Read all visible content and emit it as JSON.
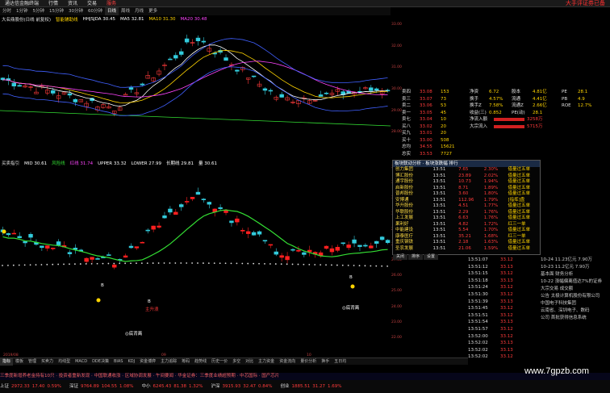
{
  "app": {
    "brand": "大手评证券已备"
  },
  "menu": [
    "通达信金融终端",
    "行情",
    "资讯",
    "交易",
    "服务"
  ],
  "menu_active_index": 4,
  "periods": [
    "分时",
    "1分钟",
    "5分钟",
    "15分钟",
    "30分钟",
    "60分钟",
    "日线",
    "周线",
    "月线",
    "更多"
  ],
  "period_active_index": 6,
  "main_legend": {
    "name": "大名鼎股份(日线 前复权)",
    "ind": "智能辅助线",
    "items": [
      {
        "label": "HHJSJDA",
        "value": "30.45",
        "color": "#ffffff"
      },
      {
        "label": "MA5",
        "value": "32.81",
        "color": "#ffffff"
      },
      {
        "label": "MA10",
        "value": "31.30",
        "color": "#ffd400"
      },
      {
        "label": "MA20",
        "value": "30.48",
        "color": "#ff44ff"
      }
    ]
  },
  "ind_legend": {
    "name": "买卖指引",
    "items": [
      {
        "label": "MID",
        "value": "30.61",
        "color": "#ffffff"
      },
      {
        "label": "风险线",
        "value": "",
        "color": "#33dd33"
      },
      {
        "label": "红线",
        "value": "31.74",
        "color": "#ff44ff"
      },
      {
        "label": "UPPER",
        "value": "33.32",
        "color": "#ffffff"
      },
      {
        "label": "LOWER",
        "value": "27.99",
        "color": "#ffffff"
      },
      {
        "label": "长期线",
        "value": "29.81",
        "color": "#ffffff"
      },
      {
        "label": "量",
        "value": "30.61",
        "color": "#ffffff"
      }
    ]
  },
  "main_scale": [
    "33.00",
    "32.00",
    "31.00",
    "30.00",
    "29.00",
    "28.00"
  ],
  "ind_scale": [
    "33.00",
    "32.00",
    "31.00",
    "30.00",
    "29.00",
    "28.00",
    "27.00",
    "26.00",
    "25.00",
    "24.00",
    "23.00",
    "22.00"
  ],
  "order_book": {
    "asks": [
      {
        "lvl": "卖四",
        "price": "33.08",
        "vol": "153"
      },
      {
        "lvl": "卖三",
        "price": "33.07",
        "vol": "73"
      },
      {
        "lvl": "卖二",
        "price": "33.06",
        "vol": "53"
      },
      {
        "lvl": "卖一",
        "price": "33.05",
        "vol": "45"
      },
      {
        "lvl": "卖七",
        "price": "33.04",
        "vol": "10"
      },
      {
        "lvl": "买八",
        "price": "33.02",
        "vol": "20"
      },
      {
        "lvl": "买九",
        "price": "33.01",
        "vol": "20"
      },
      {
        "lvl": "买十",
        "price": "33.00",
        "vol": "508"
      }
    ],
    "summary": [
      {
        "lvl": "总均",
        "price": "34.55",
        "vol": "15621"
      },
      {
        "lvl": "总实",
        "price": "33.53",
        "vol": "7727"
      }
    ]
  },
  "stats": [
    {
      "k": "净资",
      "v": "6.72",
      "k2": "股本",
      "v2": "4.81亿"
    },
    {
      "k": "换手",
      "v": "4.57%",
      "k2": "流通",
      "v2": "4.41亿"
    },
    {
      "k": "换手Z",
      "v": "7.58%",
      "k2": "流通Z",
      "v2": "2.66亿"
    },
    {
      "k": "收益(三)",
      "v": "0.852",
      "k2": "PE(动)",
      "v2": "28.1"
    }
  ],
  "flow": [
    {
      "k": "净流入额",
      "v": "3258万"
    },
    {
      "k": "大宗流入",
      "v": "5715万"
    }
  ],
  "pe": [
    {
      "k": "PE",
      "v": "28.1"
    },
    {
      "k": "PB",
      "v": "4.9"
    },
    {
      "k": "ROE",
      "v": "12.7%"
    }
  ],
  "popup": {
    "title": "板块联动分析 · 板块涨跌幅 排行",
    "rows": [
      {
        "name": "创力集团",
        "time": "13:51",
        "price": "7.65",
        "pct": "2.30%",
        "tag": "借量过五单"
      },
      {
        "name": "博汇股份",
        "time": "13:51",
        "price": "23.89",
        "pct": "2.02%",
        "tag": "借量过五单"
      },
      {
        "name": "通宇股份",
        "time": "13:51",
        "price": "10.73",
        "pct": "1.94%",
        "tag": "借量过五单"
      },
      {
        "name": "启新股份",
        "time": "13:51",
        "price": "8.71",
        "pct": "1.89%",
        "tag": "借量过五单"
      },
      {
        "name": "普邦股份",
        "time": "13:51",
        "price": "3.60",
        "pct": "1.80%",
        "tag": "借量过五单"
      },
      {
        "name": "安博通",
        "time": "13:51",
        "price": "112.96",
        "pct": "1.79%",
        "tag": "[指挥]盘"
      },
      {
        "name": "华升股份",
        "time": "13:51",
        "price": "4.51",
        "pct": "1.77%",
        "tag": "借量过五单"
      },
      {
        "name": "华联股份",
        "time": "13:51",
        "price": "2.29",
        "pct": "1.76%",
        "tag": "借量过五单"
      },
      {
        "name": "上工发展",
        "time": "13:51",
        "price": "6.63",
        "pct": "1.76%",
        "tag": "借量过五单"
      },
      {
        "name": "果利好",
        "time": "13:51",
        "price": "4.82",
        "pct": "1.72%",
        "tag": "红三一单"
      },
      {
        "name": "中能建设",
        "time": "13:51",
        "price": "5.54",
        "pct": "1.70%",
        "tag": "借量过五单"
      },
      {
        "name": "康泰医疗",
        "time": "13:51",
        "price": "35.21",
        "pct": "1.68%",
        "tag": "红三一单"
      },
      {
        "name": "重庆钢铁",
        "time": "13:51",
        "price": "2.18",
        "pct": "1.63%",
        "tag": "借量过五单"
      },
      {
        "name": "圣农发展",
        "time": "13:51",
        "price": "21.06",
        "pct": "1.59%",
        "tag": "借量过五单"
      }
    ],
    "foot": [
      "关闭",
      "排序",
      "设置"
    ]
  },
  "ticks": [
    {
      "t": "13:51:07",
      "v": "33.12"
    },
    {
      "t": "13:51:12",
      "v": "33.13"
    },
    {
      "t": "13:51:15",
      "v": "33.12"
    },
    {
      "t": "13:51:18",
      "v": "33.13"
    },
    {
      "t": "13:51:24",
      "v": "33.12"
    },
    {
      "t": "13:51:30",
      "v": "33.12"
    },
    {
      "t": "13:51:39",
      "v": "33.13"
    },
    {
      "t": "13:51:45",
      "v": "33.12"
    },
    {
      "t": "13:51:51",
      "v": "33.12"
    },
    {
      "t": "13:51:54",
      "v": "33.13"
    },
    {
      "t": "13:51:57",
      "v": "33.12"
    },
    {
      "t": "13:52:00",
      "v": "33.12"
    },
    {
      "t": "13:52:02",
      "v": "33.13"
    },
    {
      "t": "13:52:02",
      "v": "33.13"
    },
    {
      "t": "13:52:02",
      "v": "33.12"
    }
  ],
  "news": [
    "10-24  11.23亿元  7.90万",
    "10-23  11.2亿元  7.90万",
    "基本面  财务分析",
    "10-22  涨幅偏离值达7%的证券",
    "大宗交易  成交额",
    "公告  太极计算机股份有限公司",
    "中国电子科技集团",
    "云南省、深圳电子、数码",
    "公司 首批获得信息系统"
  ],
  "tabs": [
    "指标",
    "模板",
    "管理",
    "买卖力",
    "均线型",
    "MACD",
    "DDE决策",
    "BIAS",
    "KDJ",
    "资金博弈",
    "主力追踪",
    "筹码",
    "趋势线",
    "历史一价",
    "多空",
    "对比",
    "主力资金",
    "资金流向",
    "量价分析",
    "换手",
    "五日均"
  ],
  "tab_active_index": 0,
  "ticker": "三季度新增养老金持有10只 · 投资者重新发现 · 中国联通收涨 · 区域协调发展 · 午间要闻 · 华金证券：三季度业绩超预期 · 中芯国际 · 国产芯片",
  "status": [
    {
      "k": "上证",
      "v": "2972.33",
      "c": "17.40",
      "p": "0.59%",
      "cls": "up"
    },
    {
      "k": "深证",
      "v": "9764.89",
      "c": "104.55",
      "p": "1.08%",
      "cls": "up"
    },
    {
      "k": "中小",
      "v": "6245.43",
      "c": "81.38",
      "p": "1.32%",
      "cls": "up"
    },
    {
      "k": "沪深",
      "v": "3915.93",
      "c": "32.47",
      "p": "0.84%",
      "cls": "up"
    },
    {
      "k": "创业",
      "v": "1885.51",
      "c": "31.27",
      "p": "1.69%",
      "cls": "up"
    }
  ],
  "watermark": "www.7gpzb.com",
  "dates": [
    "2019/08",
    "09",
    "10"
  ],
  "markers": [
    "B",
    "B",
    "B",
    "◎底背离",
    "◎底背离",
    "主升浪"
  ]
}
